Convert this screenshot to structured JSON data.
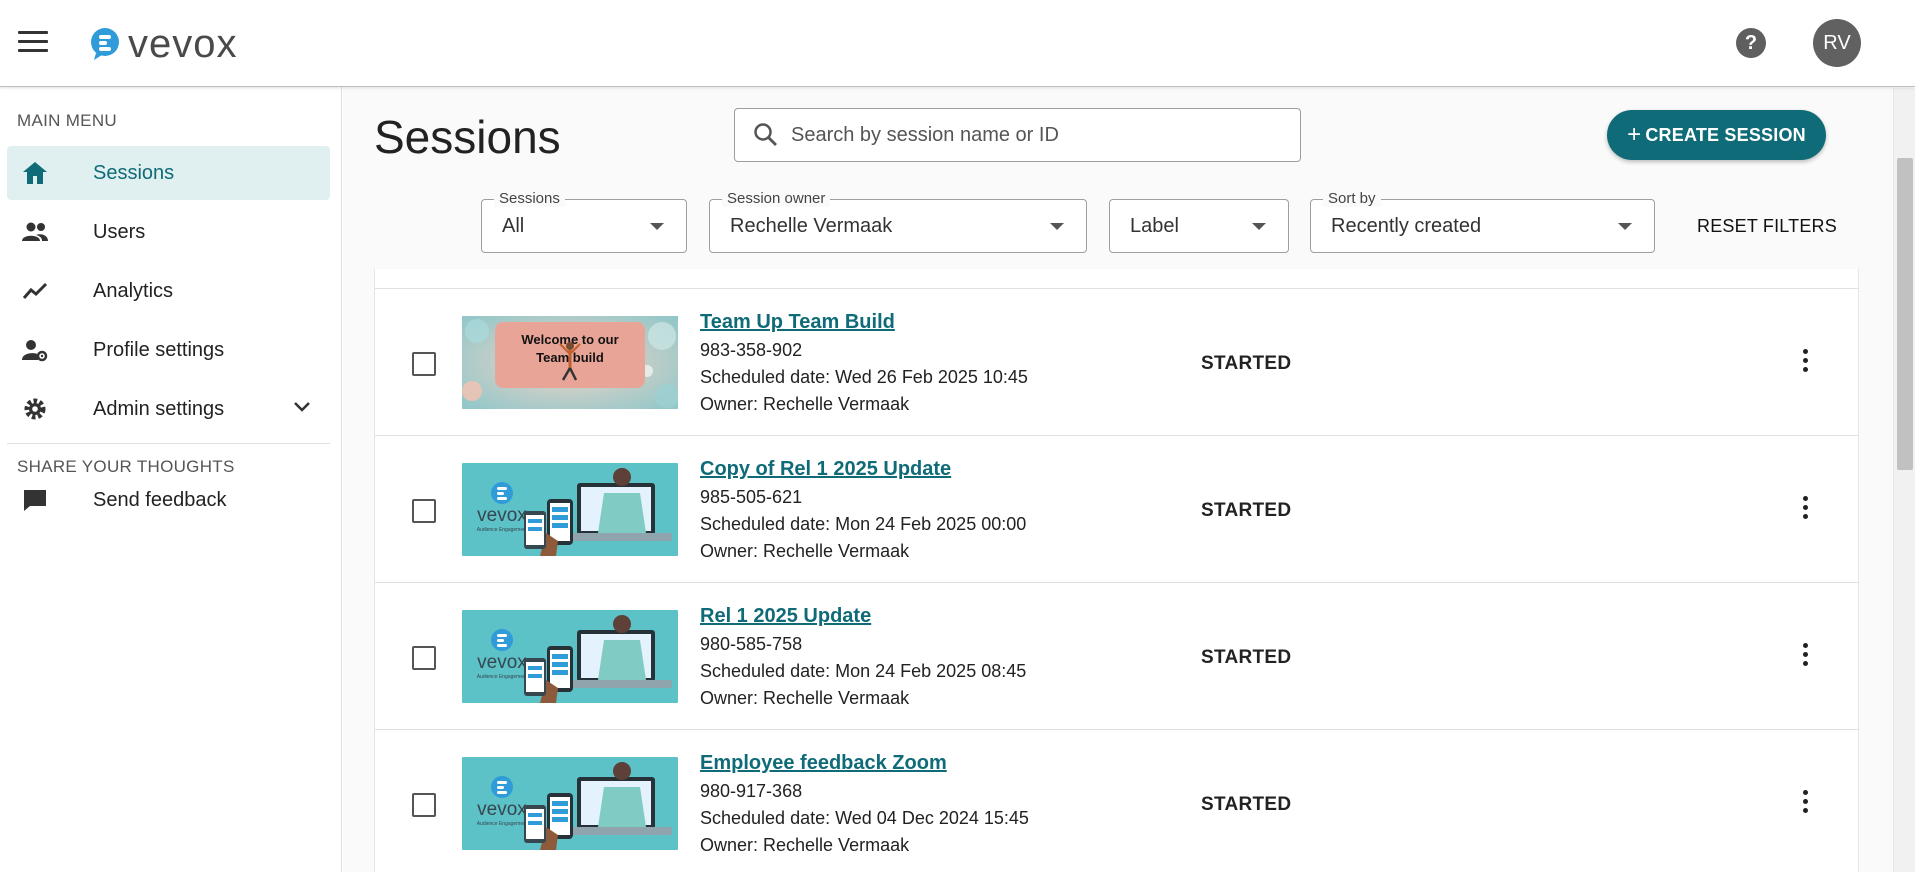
{
  "header": {
    "logo_text": "vevox",
    "help_label": "?",
    "avatar_initials": "RV"
  },
  "sidebar": {
    "main_menu_title": "MAIN MENU",
    "items": [
      {
        "label": "Sessions",
        "icon": "home-icon",
        "active": true
      },
      {
        "label": "Users",
        "icon": "users-icon"
      },
      {
        "label": "Analytics",
        "icon": "analytics-icon"
      },
      {
        "label": "Profile settings",
        "icon": "profile-settings-icon"
      },
      {
        "label": "Admin settings",
        "icon": "gear-icon"
      }
    ],
    "feedback_title": "SHARE YOUR THOUGHTS",
    "feedback_label": "Send feedback"
  },
  "main": {
    "title": "Sessions",
    "search_placeholder": "Search by session name or ID",
    "create_label": "CREATE SESSION",
    "create_plus": "+",
    "filters": {
      "sessions": {
        "label": "Sessions",
        "value": "All"
      },
      "owner": {
        "label": "Session owner",
        "value": "Rechelle Vermaak"
      },
      "label": {
        "value": "Label"
      },
      "sort": {
        "label": "Sort by",
        "value": "Recently created"
      }
    },
    "reset_label": "RESET FILTERS"
  },
  "sessions": [
    {
      "title": "Team Up Team Build",
      "id": "983-358-902",
      "date": "Scheduled date: Wed 26 Feb 2025 10:45",
      "owner": "Owner: Rechelle Vermaak",
      "status": "STARTED",
      "thumb_type": "team",
      "thumb_line1": "Welcome to our",
      "thumb_line2": "Team build"
    },
    {
      "title": "Copy of Rel 1 2025 Update",
      "id": "985-505-621",
      "date": "Scheduled date: Mon 24 Feb 2025 00:00",
      "owner": "Owner: Rechelle Vermaak",
      "status": "STARTED",
      "thumb_type": "vevox",
      "thumb_logo": "vevox",
      "thumb_tagline": "Audience Engagement"
    },
    {
      "title": "Rel 1 2025 Update",
      "id": "980-585-758",
      "date": "Scheduled date: Mon 24 Feb 2025 08:45",
      "owner": "Owner: Rechelle Vermaak",
      "status": "STARTED",
      "thumb_type": "vevox",
      "thumb_logo": "vevox",
      "thumb_tagline": "Audience Engagement"
    },
    {
      "title": "Employee feedback Zoom",
      "id": "980-917-368",
      "date": "Scheduled date: Wed 04 Dec 2024 15:45",
      "owner": "Owner: Rechelle Vermaak",
      "status": "STARTED",
      "thumb_type": "vevox",
      "thumb_logo": "vevox",
      "thumb_tagline": "Audience Engagement"
    }
  ],
  "colors": {
    "accent": "#0f6b77",
    "active_bg": "#e0f0f1",
    "logo_blue": "#2f9bd8"
  }
}
